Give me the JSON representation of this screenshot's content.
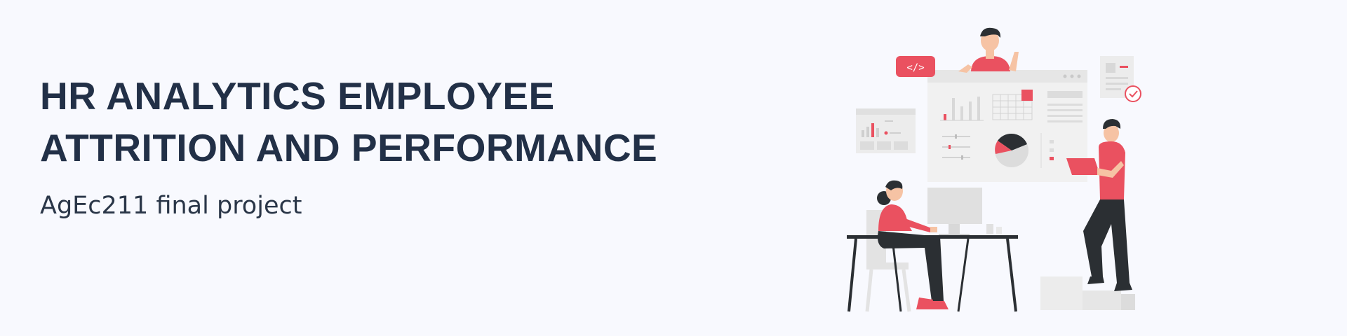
{
  "banner": {
    "title_line1": "HR ANALYTICS EMPLOYEE",
    "title_line2": "ATTRITION AND PERFORMANCE",
    "subtitle": "AgEc211 final project"
  },
  "colors": {
    "background": "#f8f9fe",
    "title": "#223047",
    "accent": "#ea5160",
    "dark": "#2b2f33",
    "light_gray": "#e4e4e4"
  },
  "illustration": {
    "icon": "team-data-analytics-illustration"
  }
}
